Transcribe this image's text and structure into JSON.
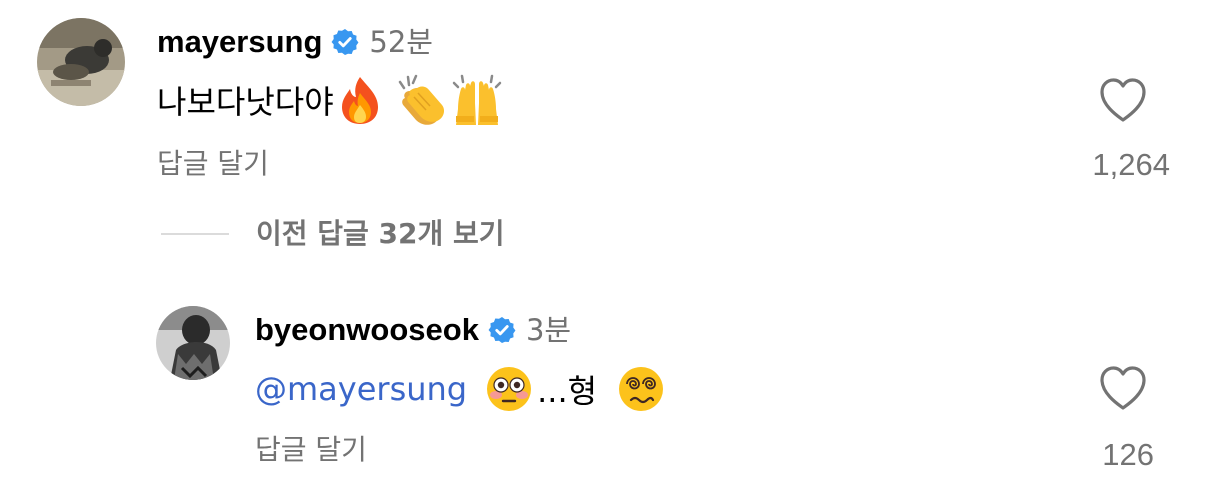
{
  "comments": [
    {
      "username": "mayersung",
      "verified": true,
      "time": "52분",
      "text": "나보다낫다야",
      "emojis": [
        "fire-emoji",
        "clapping-hands-emoji",
        "raising-hands-emoji"
      ],
      "reply_label": "답글 달기",
      "like_count": "1,264"
    },
    {
      "username": "byeonwooseok",
      "verified": true,
      "time": "3분",
      "mention": "@mayersung",
      "text_after_first_emoji": "...형",
      "emojis": [
        "flushed-face-emoji",
        "face-with-spiral-eyes-emoji"
      ],
      "reply_label": "답글 달기",
      "like_count": "126"
    }
  ],
  "view_replies_label": "이전 답글 32개 보기",
  "colors": {
    "verified_badge": "#3897f0",
    "mention": "#3a66c9",
    "secondary_text": "#737373",
    "divider": "#dbdbdb"
  }
}
